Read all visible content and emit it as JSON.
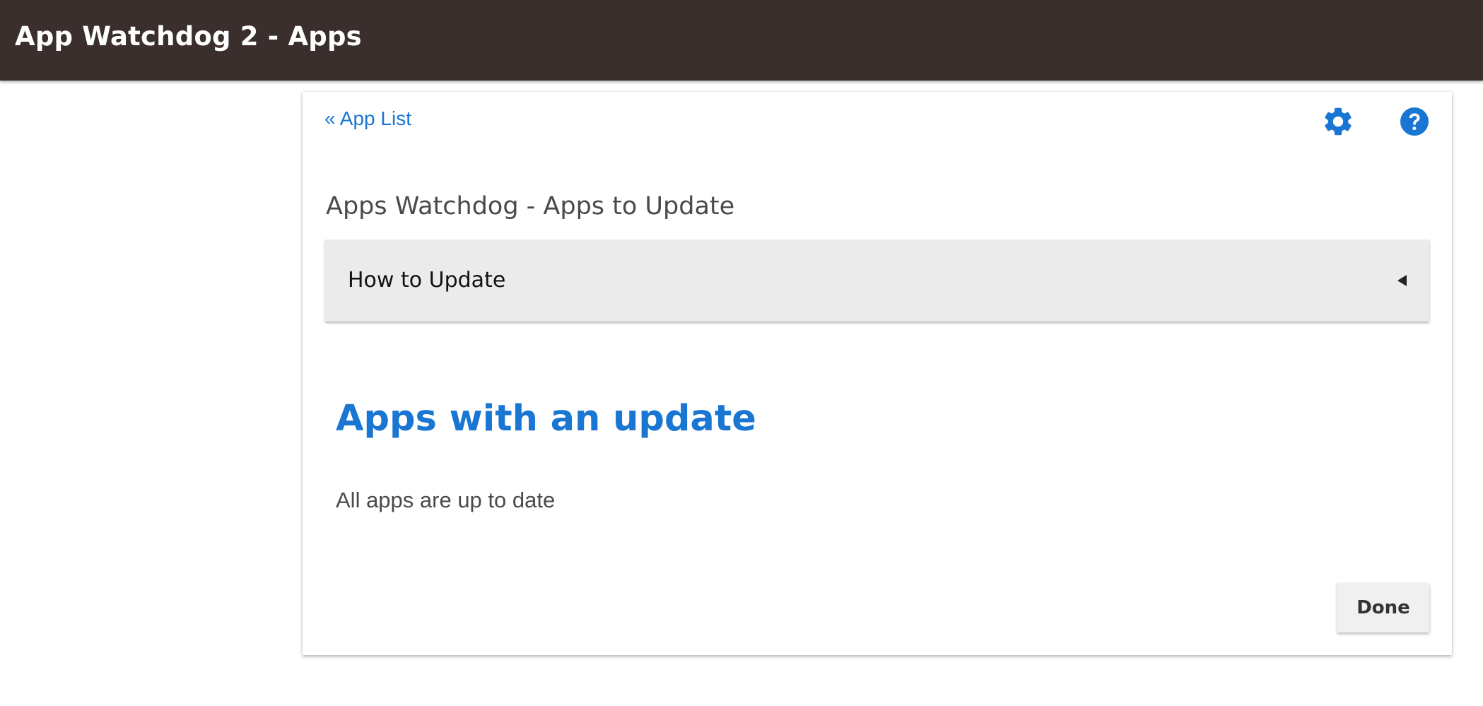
{
  "header": {
    "title": "App Watchdog 2 - Apps"
  },
  "nav": {
    "back_link": "« App List"
  },
  "toolbar": {
    "settings_icon": "gear-icon",
    "help_icon": "help-icon"
  },
  "page": {
    "heading": "Apps Watchdog - Apps to Update"
  },
  "accordion": {
    "label": "How to Update",
    "state": "collapsed"
  },
  "section": {
    "title": "Apps with an update",
    "status": "All apps are up to date"
  },
  "actions": {
    "done_label": "Done"
  },
  "colors": {
    "header_bg": "#3b2f2d",
    "accent": "#1976d2",
    "accordion_bg": "#ebebeb"
  }
}
